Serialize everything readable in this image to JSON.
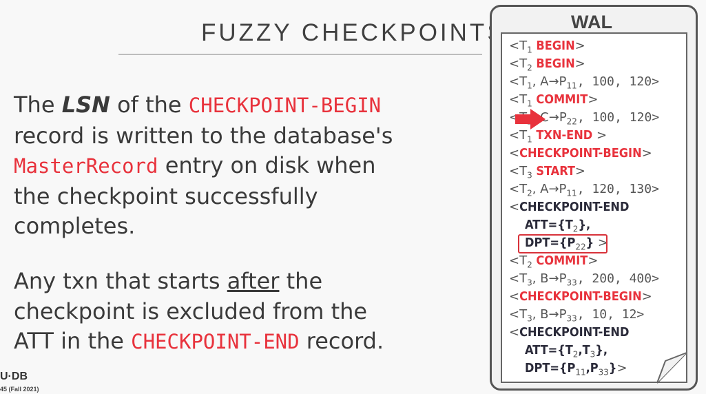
{
  "slide": {
    "title": "FUZZY CHECKPOINTS",
    "bullet1": {
      "p1": "The ",
      "lsn": "LSN",
      "p2": " of the ",
      "code1": "CHECKPOINT-BEGIN",
      "p3": " record is written to the database's ",
      "code2": "MasterRecord",
      "p4": " entry on disk when the checkpoint successfully completes."
    },
    "bullet2": {
      "p1": "Any txn that starts ",
      "after": "after",
      "p2": " the checkpoint is excluded from the ATT in the ",
      "code1": "CHECKPOINT-END",
      "p3": " record."
    },
    "footer_logo": "U·DB",
    "footer_course": "45 (Fall 2021)"
  },
  "wal": {
    "title": "WAL",
    "lines": [
      {
        "pre": "<T",
        "sub": "1",
        "kw": " BEGIN",
        "post": ">"
      },
      {
        "pre": "<T",
        "sub": "2",
        "kw": " BEGIN",
        "post": ">"
      },
      {
        "pre": "<T",
        "sub": "1",
        "mid": ", A→P",
        "sub2": "11",
        "nums": ", 100, 120>"
      },
      {
        "pre": "<T",
        "sub": "1",
        "kw": " COMMIT",
        "post": ">"
      },
      {
        "pre": "<T",
        "sub": "2",
        "mid": ", C→P",
        "sub2": "22",
        "nums": ", 100, 120>"
      },
      {
        "pre": "<T",
        "sub": "1",
        "kw": " TXN-END",
        "post": " >"
      },
      {
        "pre": "<",
        "kw": "CHECKPOINT-BEGIN",
        "post": ">"
      },
      {
        "pre": "<T",
        "sub": "3",
        "kw": " START",
        "post": ">"
      },
      {
        "pre": "<T",
        "sub": "2",
        "mid": ", A→P",
        "sub2": "11",
        "nums": ", 120, 130>"
      },
      {
        "pre": "<",
        "kw": "CHECKPOINT-END"
      },
      {
        "pre": "  ",
        "kw": "ATT={T",
        "sub": "2",
        "kw2": "},"
      },
      {
        "pre": "  ",
        "kw": "DPT={P",
        "sub": "22",
        "kw2": "}",
        "post": " >"
      },
      {
        "pre": "<T",
        "sub": "2",
        "kw": " COMMIT",
        "post": ">"
      },
      {
        "pre": "<T",
        "sub": "3",
        "mid": ", B→P",
        "sub2": "33",
        "nums": ", 200, 400>"
      },
      {
        "pre": "<",
        "kw": "CHECKPOINT-BEGIN",
        "post": ">"
      },
      {
        "pre": "<T",
        "sub": "3",
        "mid": ", B→P",
        "sub2": "33",
        "nums": ", 10, 12>"
      },
      {
        "pre": "<",
        "kw": "CHECKPOINT-END"
      },
      {
        "pre": "  ",
        "kw": "ATT={T",
        "sub": "2",
        "kw2": ",T",
        "sub3": "3",
        "kw3": "},"
      },
      {
        "pre": "  ",
        "kw": "DPT={P",
        "sub": "11",
        "kw2": ",P",
        "sub3": "33",
        "kw3": "}",
        "post": ">"
      }
    ]
  },
  "colors": {
    "red": "#e8323c",
    "text": "#3a3a3a"
  }
}
